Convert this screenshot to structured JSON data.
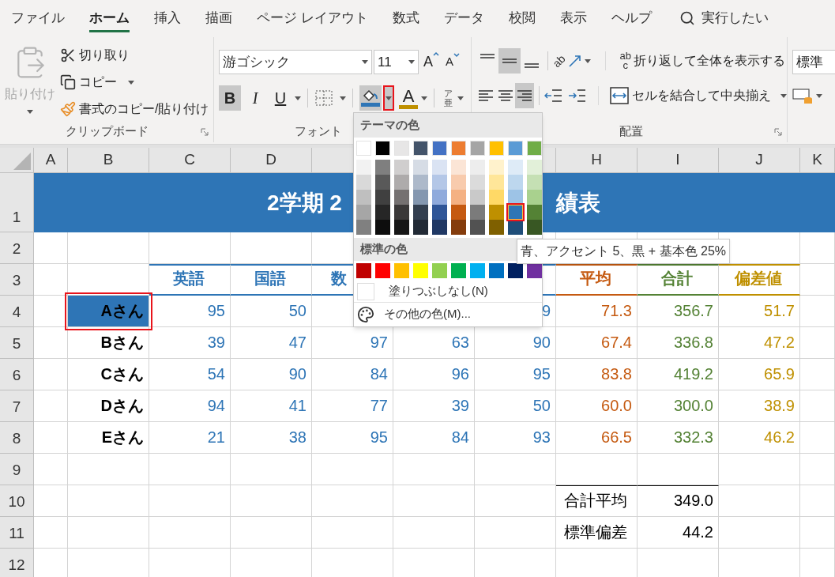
{
  "tabs": [
    {
      "label": "ファイル",
      "selected": false
    },
    {
      "label": "ホーム",
      "selected": true
    },
    {
      "label": "挿入",
      "selected": false
    },
    {
      "label": "描画",
      "selected": false
    },
    {
      "label": "ページ レイアウト",
      "selected": false
    },
    {
      "label": "数式",
      "selected": false
    },
    {
      "label": "データ",
      "selected": false
    },
    {
      "label": "校閲",
      "selected": false
    },
    {
      "label": "表示",
      "selected": false
    },
    {
      "label": "ヘルプ",
      "selected": false
    }
  ],
  "search": "実行したい",
  "clipboard": {
    "paste": {
      "label": "貼り付け",
      "disabled": true
    },
    "cut": "切り取り",
    "copy": "コピー",
    "painter": "書式のコピー/貼り付け",
    "label": "クリップボード"
  },
  "font": {
    "name": "游ゴシック",
    "size": "11",
    "grow": "A",
    "shrink": "A",
    "styles": [
      {
        "label": "B",
        "selected": true
      },
      {
        "label": "I",
        "selected": false
      },
      {
        "label": "U",
        "selected": false
      }
    ],
    "fill_dropdown_highlighted": true,
    "font_color_glyph": "A",
    "phonetic_top": "ア",
    "phonetic_bottom": "亜",
    "label": "フォント"
  },
  "alignment": {
    "vertical": [
      {
        "selected": false
      },
      {
        "selected": true
      },
      {
        "selected": false
      }
    ],
    "horizontal": [
      {
        "selected": false
      },
      {
        "selected": false
      },
      {
        "selected": true
      }
    ],
    "orientation_glyph": "ab",
    "wrap_glyph_top": "ab",
    "wrap_glyph_bottom": "c",
    "wrap": "折り返して全体を表示する",
    "merge": "セルを結合して中央揃え",
    "label": "配置"
  },
  "number": {
    "format": "標準"
  },
  "column_headers": {
    "left": [
      "A",
      "B",
      "C",
      "D"
    ],
    "right": [
      "H",
      "I",
      "J",
      "K"
    ]
  },
  "rows": [
    {
      "kind": "title",
      "number": "1",
      "left": "2学期 2",
      "right": "績表"
    },
    {
      "kind": "blank",
      "number": "2"
    },
    {
      "kind": "header",
      "number": "3",
      "cells": {
        "C": "英語",
        "D": "国語",
        "E": "数",
        "H": "平均",
        "I": "合計",
        "J": "偏差値"
      }
    },
    {
      "kind": "student",
      "number": "4",
      "selected": true,
      "cells": {
        "B": "Aさん",
        "C": "95",
        "D": "50",
        "G": "9",
        "H": "71.3",
        "I": "356.7",
        "J": "51.7"
      }
    },
    {
      "kind": "student",
      "number": "5",
      "selected": false,
      "cells": {
        "B": "Bさん",
        "C": "39",
        "D": "47",
        "E": "97",
        "F": "63",
        "G": "90",
        "H": "67.4",
        "I": "336.8",
        "J": "47.2"
      }
    },
    {
      "kind": "student",
      "number": "6",
      "selected": false,
      "cells": {
        "B": "Cさん",
        "C": "54",
        "D": "90",
        "E": "84",
        "F": "96",
        "G": "95",
        "H": "83.8",
        "I": "419.2",
        "J": "65.9"
      }
    },
    {
      "kind": "student",
      "number": "7",
      "selected": false,
      "cells": {
        "B": "Dさん",
        "C": "94",
        "D": "41",
        "E": "77",
        "F": "39",
        "G": "50",
        "H": "60.0",
        "I": "300.0",
        "J": "38.9"
      }
    },
    {
      "kind": "student",
      "number": "8",
      "selected": false,
      "cells": {
        "B": "Eさん",
        "C": "21",
        "D": "38",
        "E": "95",
        "F": "84",
        "G": "93",
        "H": "66.5",
        "I": "332.3",
        "J": "46.2"
      }
    },
    {
      "kind": "blank",
      "number": "9"
    },
    {
      "kind": "summary",
      "number": "10",
      "ruled": true,
      "cells": {
        "H": "合計平均",
        "I": "349.0"
      }
    },
    {
      "kind": "summary",
      "number": "11",
      "ruled": false,
      "cells": {
        "H": "標準偏差",
        "I": "44.2"
      }
    },
    {
      "kind": "blank",
      "number": "12"
    }
  ],
  "palette": {
    "theme_title": "テーマの色",
    "theme": [
      {
        "color": "#ffffff",
        "selected": false,
        "shades": [
          {
            "color": "#f2f2f2",
            "selected": false
          },
          {
            "color": "#d9d9d9",
            "selected": false
          },
          {
            "color": "#bfbfbf",
            "selected": false
          },
          {
            "color": "#a6a6a6",
            "selected": false
          },
          {
            "color": "#808080",
            "selected": false
          }
        ]
      },
      {
        "color": "#000000",
        "selected": false,
        "shades": [
          {
            "color": "#7f7f7f",
            "selected": false
          },
          {
            "color": "#595959",
            "selected": false
          },
          {
            "color": "#404040",
            "selected": false
          },
          {
            "color": "#262626",
            "selected": false
          },
          {
            "color": "#0d0d0d",
            "selected": false
          }
        ]
      },
      {
        "color": "#e7e6e6",
        "selected": false,
        "shades": [
          {
            "color": "#d0cece",
            "selected": false
          },
          {
            "color": "#aeabab",
            "selected": false
          },
          {
            "color": "#757171",
            "selected": false
          },
          {
            "color": "#3a3838",
            "selected": false
          },
          {
            "color": "#161616",
            "selected": false
          }
        ]
      },
      {
        "color": "#44546a",
        "selected": false,
        "shades": [
          {
            "color": "#d6dce5",
            "selected": false
          },
          {
            "color": "#adb9ca",
            "selected": false
          },
          {
            "color": "#8497b0",
            "selected": false
          },
          {
            "color": "#333f50",
            "selected": false
          },
          {
            "color": "#222a35",
            "selected": false
          }
        ]
      },
      {
        "color": "#4472c4",
        "selected": false,
        "shades": [
          {
            "color": "#dae3f3",
            "selected": false
          },
          {
            "color": "#b4c7e7",
            "selected": false
          },
          {
            "color": "#8faadc",
            "selected": false
          },
          {
            "color": "#2f5597",
            "selected": false
          },
          {
            "color": "#203864",
            "selected": false
          }
        ]
      },
      {
        "color": "#ed7d31",
        "selected": false,
        "shades": [
          {
            "color": "#fbe5d6",
            "selected": false
          },
          {
            "color": "#f8cbad",
            "selected": false
          },
          {
            "color": "#f4b183",
            "selected": false
          },
          {
            "color": "#c55a11",
            "selected": false
          },
          {
            "color": "#843c0c",
            "selected": false
          }
        ]
      },
      {
        "color": "#a5a5a5",
        "selected": false,
        "shades": [
          {
            "color": "#ededed",
            "selected": false
          },
          {
            "color": "#dbdbdb",
            "selected": false
          },
          {
            "color": "#c9c9c9",
            "selected": false
          },
          {
            "color": "#7b7b7b",
            "selected": false
          },
          {
            "color": "#525252",
            "selected": false
          }
        ]
      },
      {
        "color": "#ffc000",
        "selected": false,
        "shades": [
          {
            "color": "#fff2cc",
            "selected": false
          },
          {
            "color": "#ffe699",
            "selected": false
          },
          {
            "color": "#ffd966",
            "selected": false
          },
          {
            "color": "#bf9000",
            "selected": false
          },
          {
            "color": "#7f6000",
            "selected": false
          }
        ]
      },
      {
        "color": "#5b9bd5",
        "selected": false,
        "shades": [
          {
            "color": "#deebf7",
            "selected": false
          },
          {
            "color": "#bdd7ee",
            "selected": false
          },
          {
            "color": "#9dc3e6",
            "selected": false
          },
          {
            "color": "#2e75b6",
            "selected": true
          },
          {
            "color": "#1f4e79",
            "selected": false
          }
        ]
      },
      {
        "color": "#70ad47",
        "selected": false,
        "shades": [
          {
            "color": "#e2f0d9",
            "selected": false
          },
          {
            "color": "#c5e0b4",
            "selected": false
          },
          {
            "color": "#a9d18e",
            "selected": false
          },
          {
            "color": "#548235",
            "selected": false
          },
          {
            "color": "#385723",
            "selected": false
          }
        ]
      }
    ],
    "standard_title": "標準の色",
    "standard": [
      {
        "color": "#c00000",
        "selected": false
      },
      {
        "color": "#ff0000",
        "selected": false
      },
      {
        "color": "#ffc000",
        "selected": false
      },
      {
        "color": "#ffff00",
        "selected": false
      },
      {
        "color": "#92d050",
        "selected": false
      },
      {
        "color": "#00b050",
        "selected": false
      },
      {
        "color": "#00b0f0",
        "selected": false
      },
      {
        "color": "#0070c0",
        "selected": false
      },
      {
        "color": "#002060",
        "selected": false
      },
      {
        "color": "#7030a0",
        "selected": false
      }
    ],
    "no_fill": "塗りつぶしなし(N)",
    "more": "その他の色(M)...",
    "tooltip": "青、アクセント 5、黒 + 基本色 25%"
  }
}
